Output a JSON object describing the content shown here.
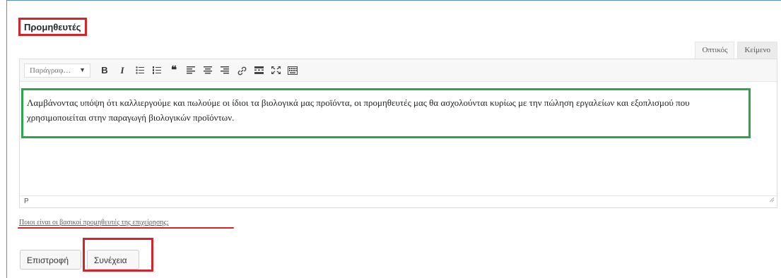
{
  "section": {
    "title": "Προμηθευτές"
  },
  "editor_tabs": {
    "visual": "Οπτικός",
    "text": "Κείμενο"
  },
  "toolbar": {
    "format_select": "Παράγραφ…",
    "buttons": [
      {
        "name": "bold",
        "glyph": "B"
      },
      {
        "name": "italic",
        "glyph": "I"
      },
      {
        "name": "bullet-list",
        "glyph": ""
      },
      {
        "name": "numbered-list",
        "glyph": ""
      },
      {
        "name": "blockquote",
        "glyph": "❝"
      },
      {
        "name": "align-left",
        "glyph": ""
      },
      {
        "name": "align-center",
        "glyph": ""
      },
      {
        "name": "align-right",
        "glyph": ""
      },
      {
        "name": "link",
        "glyph": ""
      },
      {
        "name": "read-more",
        "glyph": ""
      },
      {
        "name": "fullscreen",
        "glyph": ""
      },
      {
        "name": "toolbar-toggle",
        "glyph": ""
      }
    ]
  },
  "content": {
    "text": "Λαμβάνοντας υπόψη ότι καλλιεργούμε και πωλούμε οι ίδιοι τα βιολογικά μας προϊόντα, οι προμηθευτές μας θα ασχολούνται κυρίως με την πώληση εργαλείων και εξοπλισμού που χρησιμοποιείται στην παραγωγή βιολογικών προϊόντων."
  },
  "statusbar": {
    "path": "P"
  },
  "help": {
    "text": "Ποιοι είναι οι βασικοί προμηθευτές της επιχείρησης;"
  },
  "actions": {
    "back_label": "Επιστροφή",
    "next_label": "Συνέχεια"
  },
  "colors": {
    "highlight_red": "#d3242a",
    "highlight_green": "#2aa64b",
    "frame_blue": "#5b8fd1"
  }
}
